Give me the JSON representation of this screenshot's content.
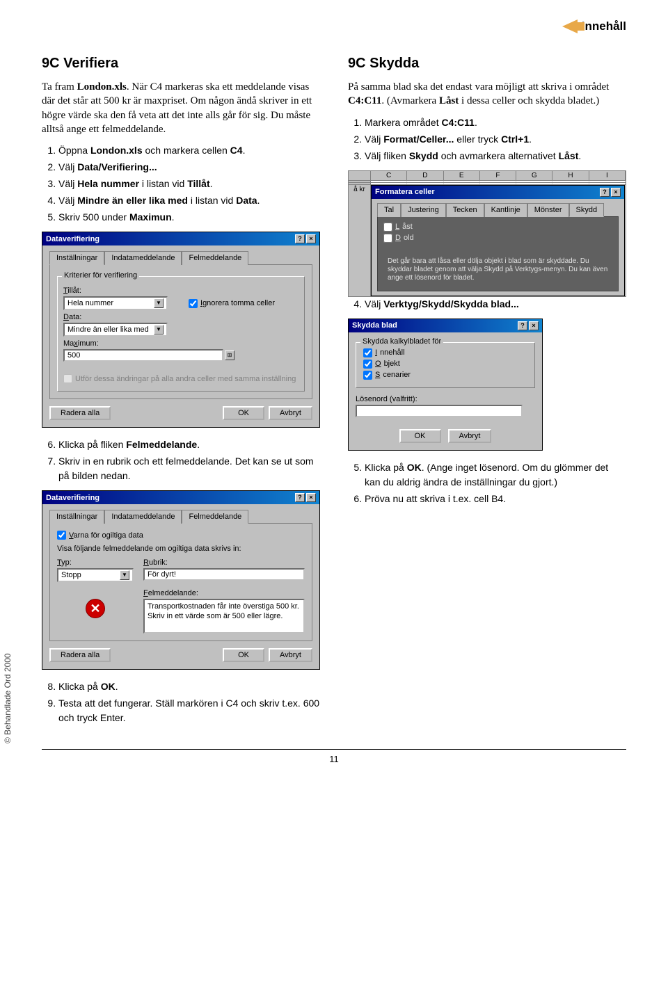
{
  "nav": {
    "toc": "Innehåll"
  },
  "left": {
    "heading": "9C Verifiera",
    "intro": "Ta fram London.xls. När C4 markeras ska ett meddelande visas där det står att 500 kr är maxpriset. Om någon ändå skriver in ett högre värde ska den få veta att det inte alls går för sig. Du måste alltså ange ett felmeddelande.",
    "steps1": [
      "Öppna London.xls och markera cellen C4.",
      "Välj Data/Verifiering...",
      "Välj Hela nummer i listan vid Tillåt.",
      "Välj Mindre än eller lika med i listan vid Data.",
      "Skriv 500 under Maximun."
    ],
    "steps2": [
      "Klicka på fliken Felmeddelande.",
      "Skriv in en rubrik och ett felmeddelande. Det kan se ut som på bilden nedan."
    ],
    "steps3": [
      "Klicka på OK.",
      "Testa att det fungerar. Ställ markören i C4 och skriv t.ex. 600 och tryck Enter."
    ]
  },
  "right": {
    "heading": "9C Skydda",
    "intro": "På samma blad ska det endast vara möjligt att skriva i området C4:C11. (Avmarkera Låst i dessa celler och skydda bladet.)",
    "steps1": [
      "Markera området C4:C11.",
      "Välj Format/Celler... eller tryck Ctrl+1.",
      "Välj fliken Skydd och avmarkera alternativet Låst."
    ],
    "step4": "Välj Verktyg/Skydd/Skydda blad...",
    "steps2": [
      "Klicka på OK. (Ange inget lösenord. Om du glömmer det kan du aldrig ändra de inställningar du gjort.)",
      "Pröva nu att skriva i t.ex. cell B4."
    ]
  },
  "dlg1": {
    "title": "Dataverifiering",
    "tabs": [
      "Inställningar",
      "Indatameddelande",
      "Felmeddelande"
    ],
    "group": "Kriterier för verifiering",
    "lbl_allow": "Tillåt:",
    "val_allow": "Hela nummer",
    "chk_ignore": "Ignorera tomma celler",
    "lbl_data": "Data:",
    "val_data": "Mindre än eller lika med",
    "lbl_max": "Maximum:",
    "val_max": "500",
    "chk_apply": "Utför dessa ändringar på alla andra celler med samma inställning",
    "btn_clear": "Radera alla",
    "btn_ok": "OK",
    "btn_cancel": "Avbryt"
  },
  "dlg2": {
    "title": "Dataverifiering",
    "tabs": [
      "Inställningar",
      "Indatameddelande",
      "Felmeddelande"
    ],
    "chk_warn": "Varna för ogiltiga data",
    "caption": "Visa följande felmeddelande om ogiltiga data skrivs in:",
    "lbl_type": "Typ:",
    "val_type": "Stopp",
    "lbl_title": "Rubrik:",
    "val_title": "För dyrt!",
    "lbl_msg": "Felmeddelande:",
    "val_msg": "Transportkostnaden får inte överstiga 500 kr.\nSkriv in ett värde som är 500 eller lägre.",
    "btn_clear": "Radera alla",
    "btn_ok": "OK",
    "btn_cancel": "Avbryt"
  },
  "sheet": {
    "cols": [
      "C",
      "D",
      "E",
      "F",
      "G",
      "H",
      "I"
    ],
    "rowlabel": "å kr"
  },
  "dlg3": {
    "title": "Formatera celler",
    "tabs": [
      "Tal",
      "Justering",
      "Tecken",
      "Kantlinje",
      "Mönster",
      "Skydd"
    ],
    "chk_locked": "Låst",
    "chk_hidden": "Dold",
    "note": "Det går bara att låsa eller dölja objekt i blad som är skyddade. Du skyddar bladet genom att välja Skydd på Verktygs-menyn. Du kan även ange ett lösenord för bladet."
  },
  "dlg4": {
    "title": "Skydda blad",
    "caption": "Skydda kalkylbladet för",
    "chk1": "Innehåll",
    "chk2": "Objekt",
    "chk3": "Scenarier",
    "lbl_pass": "Lösenord (valfritt):",
    "btn_ok": "OK",
    "btn_cancel": "Avbryt"
  },
  "footer": {
    "copyright": "© Behandlade Ord 2000",
    "page": "11"
  }
}
